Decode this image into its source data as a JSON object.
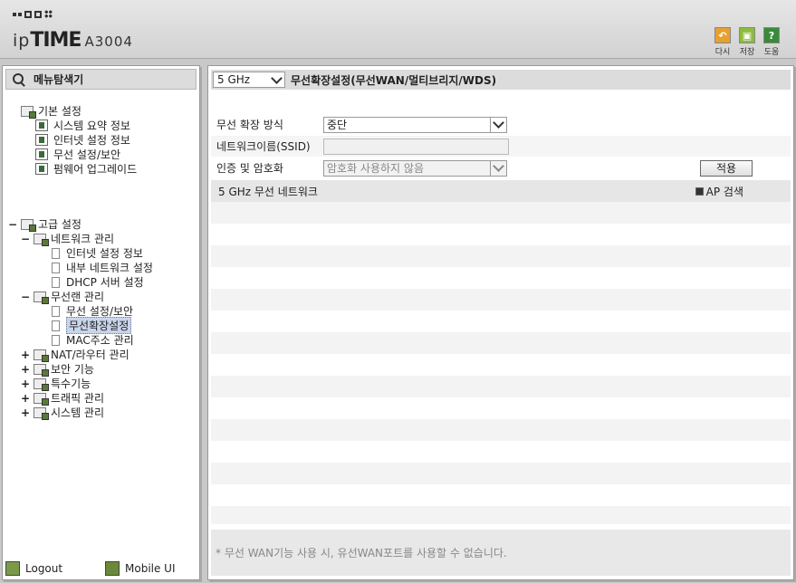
{
  "header": {
    "brand_ip": "ip",
    "brand_time": "TIME",
    "model": "A3004",
    "toolbar": [
      {
        "label": "다시",
        "icon": "undo-icon",
        "color": "#e8a030"
      },
      {
        "label": "저장",
        "icon": "save-icon",
        "color": "#8cbc3c"
      },
      {
        "label": "도움",
        "icon": "help-icon",
        "color": "#3a8a3a"
      }
    ]
  },
  "sidebar": {
    "search_label": "메뉴탐색기",
    "basic": {
      "label": "기본 설정",
      "items": [
        "시스템 요약 정보",
        "인터넷 설정 정보",
        "무선 설정/보안",
        "펌웨어 업그레이드"
      ]
    },
    "advanced": {
      "toggle": "−",
      "label": "고급 설정",
      "network": {
        "toggle": "−",
        "label": "네트워크 관리",
        "items": [
          "인터넷 설정 정보",
          "내부 네트워크 설정",
          "DHCP 서버 설정"
        ]
      },
      "wireless": {
        "toggle": "−",
        "label": "무선랜 관리",
        "items": [
          "무선 설정/보안",
          "무선확장설정",
          "MAC주소 관리"
        ],
        "selected_index": 1
      },
      "others": [
        {
          "toggle": "+",
          "label": "NAT/라우터 관리"
        },
        {
          "toggle": "+",
          "label": "보안 기능"
        },
        {
          "toggle": "+",
          "label": "특수기능"
        },
        {
          "toggle": "+",
          "label": "트래픽 관리"
        },
        {
          "toggle": "+",
          "label": "시스템 관리"
        }
      ]
    },
    "footer": {
      "logout": "Logout",
      "mobile": "Mobile UI"
    }
  },
  "main": {
    "band_select": "5 GHz",
    "title": "무선확장설정(무선WAN/멀티브리지/WDS)",
    "fields": {
      "mode_label": "무선 확장 방식",
      "mode_value": "중단",
      "ssid_label": "네트워크이름(SSID)",
      "ssid_value": "",
      "auth_label": "인증 및 암호화",
      "auth_value": "암호화 사용하지 않음"
    },
    "apply_label": "적용",
    "network_title": "5 GHz 무선 네트워크",
    "ap_search_label": "AP 검색",
    "footer_note": "* 무선 WAN기능 사용 시, 유선WAN포트를 사용할 수 없습니다."
  }
}
